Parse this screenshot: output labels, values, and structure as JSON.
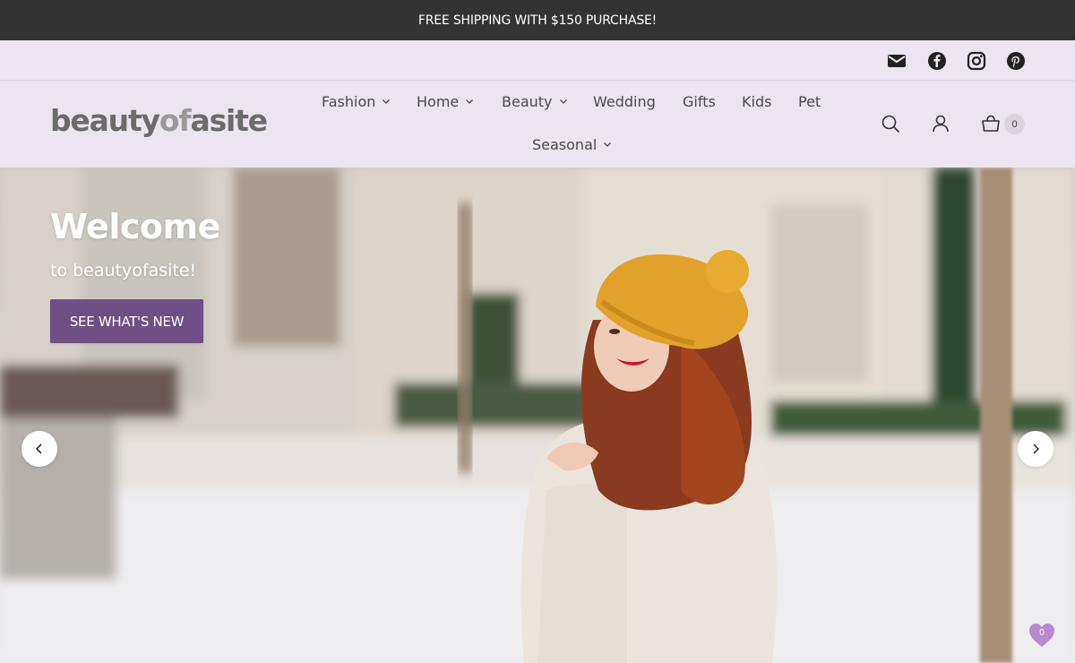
{
  "announcement": "FREE SHIPPING WITH $150 PURCHASE!",
  "social": [
    "email-icon",
    "facebook-icon",
    "instagram-icon",
    "pinterest-icon"
  ],
  "logo": {
    "part1": "beauty",
    "part2": "of",
    "part3": "asite"
  },
  "nav": {
    "fashion": "Fashion",
    "home": "Home",
    "beauty": "Beauty",
    "wedding": "Wedding",
    "gifts": "Gifts",
    "kids": "Kids",
    "pet": "Pet",
    "seasonal": "Seasonal"
  },
  "header_icons": [
    "search-icon",
    "account-icon",
    "cart-icon"
  ],
  "cart_count": "0",
  "hero": {
    "title": "Welcome",
    "subtitle": "to beautyofasite!",
    "cta": "SEE WHAT'S NEW"
  },
  "wishlist_count": "0",
  "colors": {
    "announcement_bg": "#333333",
    "header_bg": "#ece4ef",
    "cta_bg": "#6e4f85",
    "wishlist": "#b58ad1"
  }
}
